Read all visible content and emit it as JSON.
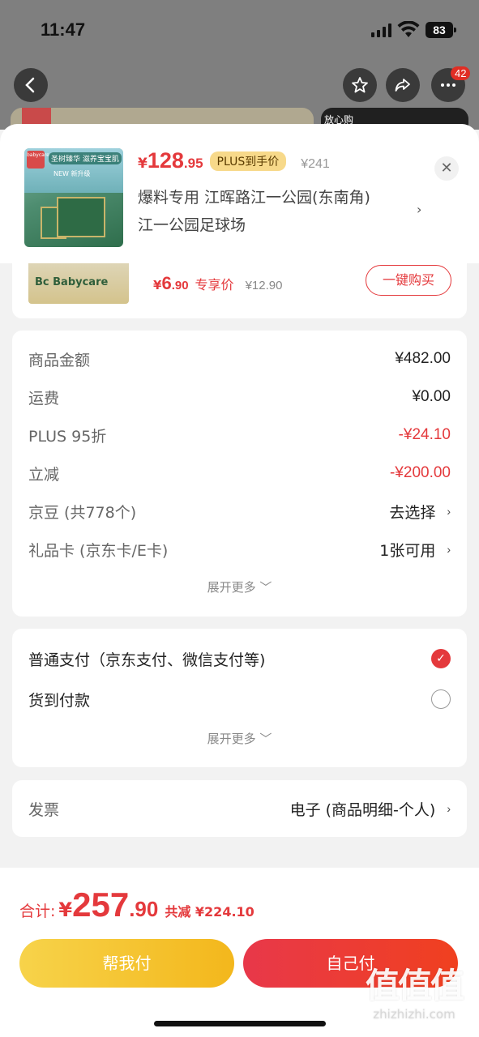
{
  "status_bar": {
    "time": "11:47",
    "battery": "83"
  },
  "nav": {
    "badge_count": "42"
  },
  "bg": {
    "right_label": "放心购"
  },
  "product": {
    "price_currency": "¥",
    "price_int": "128",
    "price_dec": ".95",
    "plus_tag": "PLUS到手价",
    "orig_price": "¥241",
    "address_line1": "爆料专用  江晖路江一公园(东南角)",
    "address_line2": "江一公园足球场",
    "thumb_brand": "babycare",
    "thumb_tag": "圣树臻华 滋养宝宝肌",
    "thumb_new": "NEW 新升级"
  },
  "addon_item": {
    "brand": "Bc Babycare",
    "price_currency": "¥",
    "price_int": "6",
    "price_dec": ".90",
    "price_label": "专享价",
    "orig_price": "¥12.90",
    "buy_label": "一键购买"
  },
  "summary": {
    "rows": [
      {
        "label": "商品金额",
        "value": "¥482.00"
      },
      {
        "label": "运费",
        "value": "¥0.00"
      },
      {
        "label": "PLUS 95折",
        "value": "-¥24.10"
      },
      {
        "label": "立减",
        "value": "-¥200.00"
      },
      {
        "label": "京豆 (共778个)",
        "value": "去选择"
      },
      {
        "label": "礼品卡 (京东卡/E卡)",
        "value": "1张可用"
      }
    ],
    "more_label": "展开更多"
  },
  "payment": {
    "options": [
      {
        "label": "普通支付（京东支付、微信支付等)",
        "selected": true
      },
      {
        "label": "货到付款",
        "selected": false
      }
    ],
    "more_label": "展开更多"
  },
  "invoice": {
    "label": "发票",
    "value": "电子 (商品明细-个人)"
  },
  "footer": {
    "total_label": "合计:",
    "total_currency": "¥",
    "total_int": "257",
    "total_dec": ".90",
    "total_save": "共减 ¥224.10",
    "help_pay_label": "帮我付",
    "self_pay_label": "自己付"
  },
  "watermark": {
    "logo": "值值值",
    "url": "zhizhizhi.com"
  },
  "colors": {
    "accent": "#e4393c",
    "plus_gold": "#f7d98a",
    "help_yellow": "#f3b71c"
  }
}
